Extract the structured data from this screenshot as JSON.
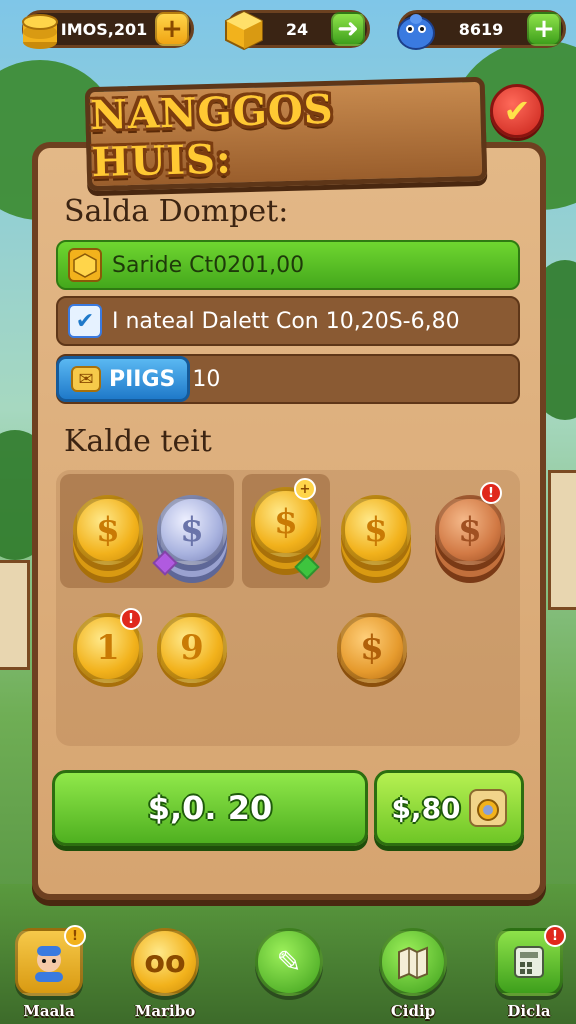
{
  "resources": [
    {
      "name": "coins",
      "value": "IMOS,201",
      "icon": "coin-stack-icon",
      "plus_color": "#f0a413"
    },
    {
      "name": "gems",
      "value": "24",
      "icon": "gold-cube-icon",
      "plus_color": "#3e9f1c"
    },
    {
      "name": "creature",
      "value": "8619",
      "icon": "blue-creature-icon",
      "plus_color": "#3e9f1c"
    }
  ],
  "header": {
    "title": "NANGGOS HUIS:",
    "confirm_icon": "checkmark-icon"
  },
  "wallet": {
    "heading": "Salda Dompet:",
    "rows": [
      {
        "icon": "gold-cube-icon",
        "text": "Saride Ct0201,00"
      },
      {
        "icon": "checkbox-icon",
        "text": "I nateal Dalett Con 10,20S-6,80"
      },
      {
        "icon": "envelope-icon",
        "pill_text": "PIIGS",
        "text": "10"
      }
    ]
  },
  "coins_section": {
    "heading": "Kalde teit",
    "items": [
      {
        "type": "gold-stack",
        "symbol": "$"
      },
      {
        "type": "silver-stack",
        "symbol": "$"
      },
      {
        "type": "gold-stack",
        "symbol": "$"
      },
      {
        "type": "gold-stack",
        "symbol": "$"
      },
      {
        "type": "bronze-stack",
        "symbol": "$"
      },
      {
        "type": "gold-coin",
        "symbol": "1"
      },
      {
        "type": "gold-coin",
        "symbol": "9"
      },
      {
        "type": "orange-coin",
        "symbol": "$"
      }
    ]
  },
  "actions": {
    "primary_label": "$,0. 20",
    "secondary_label": "$,80"
  },
  "bottom_nav": [
    {
      "label": "Maala",
      "icon": "avatar-icon"
    },
    {
      "label": "Maribo",
      "icon": "coins-icon"
    },
    {
      "label": "",
      "icon": "pencil-icon"
    },
    {
      "label": "Cidip",
      "icon": "map-icon"
    },
    {
      "label": "Dicla",
      "icon": "calculator-icon"
    }
  ],
  "colors": {
    "panel": "#d6a470",
    "panel_border": "#6e4020",
    "green_button": "#4fb020",
    "title_gold": "#ffc933",
    "accent_red": "#c8231a"
  }
}
